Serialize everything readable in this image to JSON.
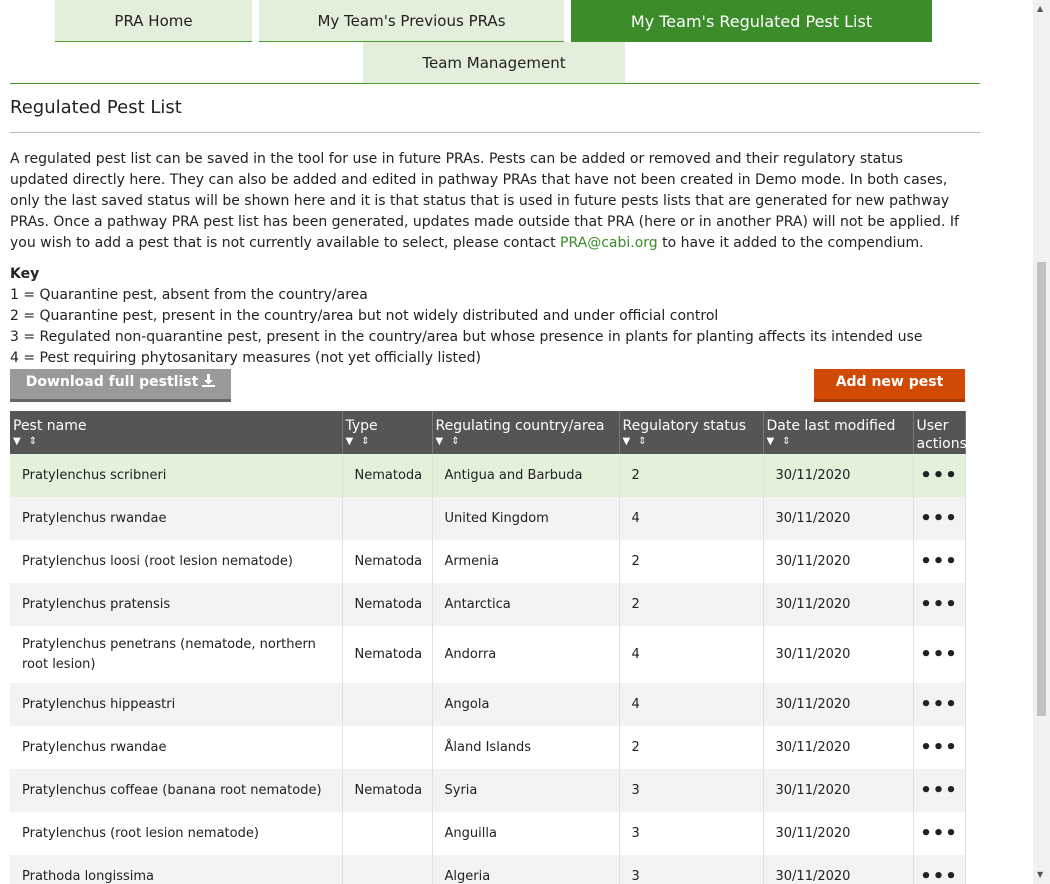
{
  "tabs": [
    {
      "label": "PRA Home",
      "active": false
    },
    {
      "label": "My Team's Previous PRAs",
      "active": false
    },
    {
      "label": "My Team's Regulated Pest List",
      "active": true
    },
    {
      "label": "Team Management",
      "active": false
    }
  ],
  "page": {
    "title": "Regulated Pest List",
    "intro_before": "A regulated pest list can be saved in the tool for use in future PRAs. Pests can be added or removed and their regulatory status updated directly here. They can also be added and edited in pathway PRAs that have not been created in Demo mode. In both cases, only the last saved status will be shown here and it is that status that is used in future pests lists that are generated for new pathway PRAs. Once a pathway PRA pest list has been generated, updates made outside that PRA (here or in another PRA) will not be applied. If you wish to add a pest that is not currently available to select, please contact ",
    "intro_link": "PRA@cabi.org",
    "intro_after": " to have it added to the compendium."
  },
  "key": {
    "title": "Key",
    "items": [
      "1 = Quarantine pest, absent from the country/area",
      "2 = Quarantine pest, present in the country/area but not widely distributed and under official control",
      "3 = Regulated non-quarantine pest, present in the country/area but whose presence in plants for planting affects its intended use",
      "4 = Pest requiring phytosanitary measures (not yet officially listed)"
    ]
  },
  "buttons": {
    "download": "Download full pestlist",
    "add": "Add new pest"
  },
  "table": {
    "headers": [
      "Pest name",
      "Type",
      "Regulating country/area",
      "Regulatory status",
      "Date last modified",
      "User actions"
    ],
    "rows": [
      {
        "name": "Pratylenchus scribneri",
        "type": "Nematoda",
        "country": "Antigua and Barbuda",
        "status": "2",
        "date": "30/11/2020"
      },
      {
        "name": "Pratylenchus rwandae",
        "type": "",
        "country": "United Kingdom",
        "status": "4",
        "date": "30/11/2020"
      },
      {
        "name": "Pratylenchus loosi (root lesion nematode)",
        "type": "Nematoda",
        "country": "Armenia",
        "status": "2",
        "date": "30/11/2020"
      },
      {
        "name": "Pratylenchus pratensis",
        "type": "Nematoda",
        "country": "Antarctica",
        "status": "2",
        "date": "30/11/2020"
      },
      {
        "name": "Pratylenchus penetrans (nematode, northern root lesion)",
        "type": "Nematoda",
        "country": "Andorra",
        "status": "4",
        "date": "30/11/2020"
      },
      {
        "name": "Pratylenchus hippeastri",
        "type": "",
        "country": "Angola",
        "status": "4",
        "date": "30/11/2020"
      },
      {
        "name": "Pratylenchus rwandae",
        "type": "",
        "country": "Åland Islands",
        "status": "2",
        "date": "30/11/2020"
      },
      {
        "name": "Pratylenchus coffeae (banana root nematode)",
        "type": "Nematoda",
        "country": "Syria",
        "status": "3",
        "date": "30/11/2020"
      },
      {
        "name": "Pratylenchus (root lesion nematode)",
        "type": "",
        "country": "Anguilla",
        "status": "3",
        "date": "30/11/2020"
      },
      {
        "name": "Prathoda longissima",
        "type": "",
        "country": "Algeria",
        "status": "3",
        "date": "30/11/2020"
      }
    ],
    "actions_glyph": "•••"
  },
  "icons": {
    "filter": "filter-icon",
    "sort": "sort-icon",
    "download": "download-icon"
  },
  "colors": {
    "accent": "#3c8c2a",
    "tab_bg": "#e3efda",
    "add_button": "#d14a04",
    "header_bg": "#555555"
  }
}
